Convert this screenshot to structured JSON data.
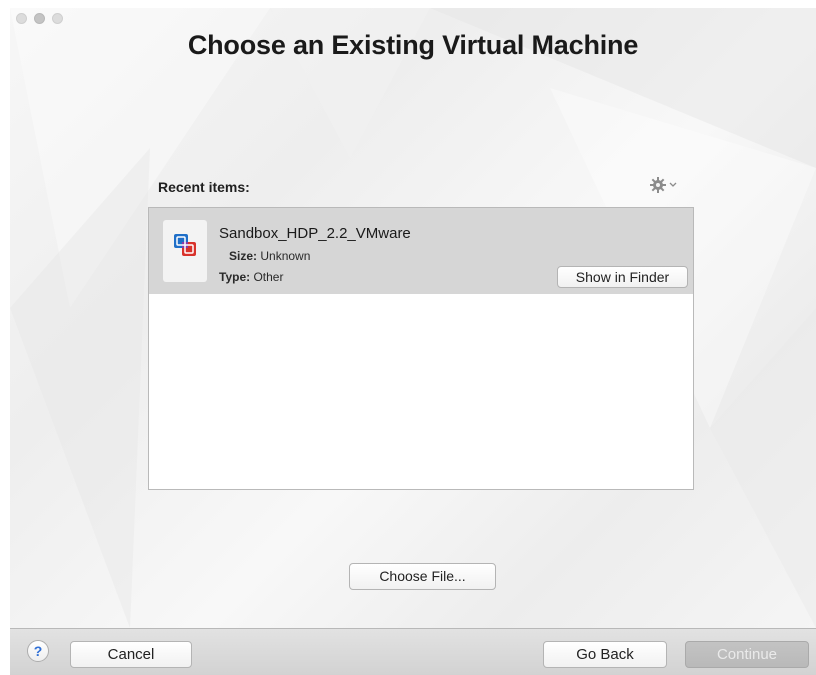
{
  "window": {
    "title": "Choose an Existing Virtual Machine"
  },
  "recent": {
    "label": "Recent items:",
    "gear_icon": "gear-icon",
    "items": [
      {
        "name": "Sandbox_HDP_2.2_VMware",
        "size_label": "Size:",
        "size_value": "Unknown",
        "type_label": "Type:",
        "type_value": "Other",
        "icon": "vmware-fusion-icon",
        "show_in_finder_label": "Show in Finder"
      }
    ]
  },
  "choose_file_label": "Choose File...",
  "footer": {
    "help_label": "?",
    "cancel_label": "Cancel",
    "go_back_label": "Go Back",
    "continue_label": "Continue"
  },
  "colors": {
    "selected_row": "#d6d6d6",
    "help_icon": "#2f6fd6",
    "vmware_blue": "#1f6fc8",
    "vmware_red": "#d8322b"
  }
}
